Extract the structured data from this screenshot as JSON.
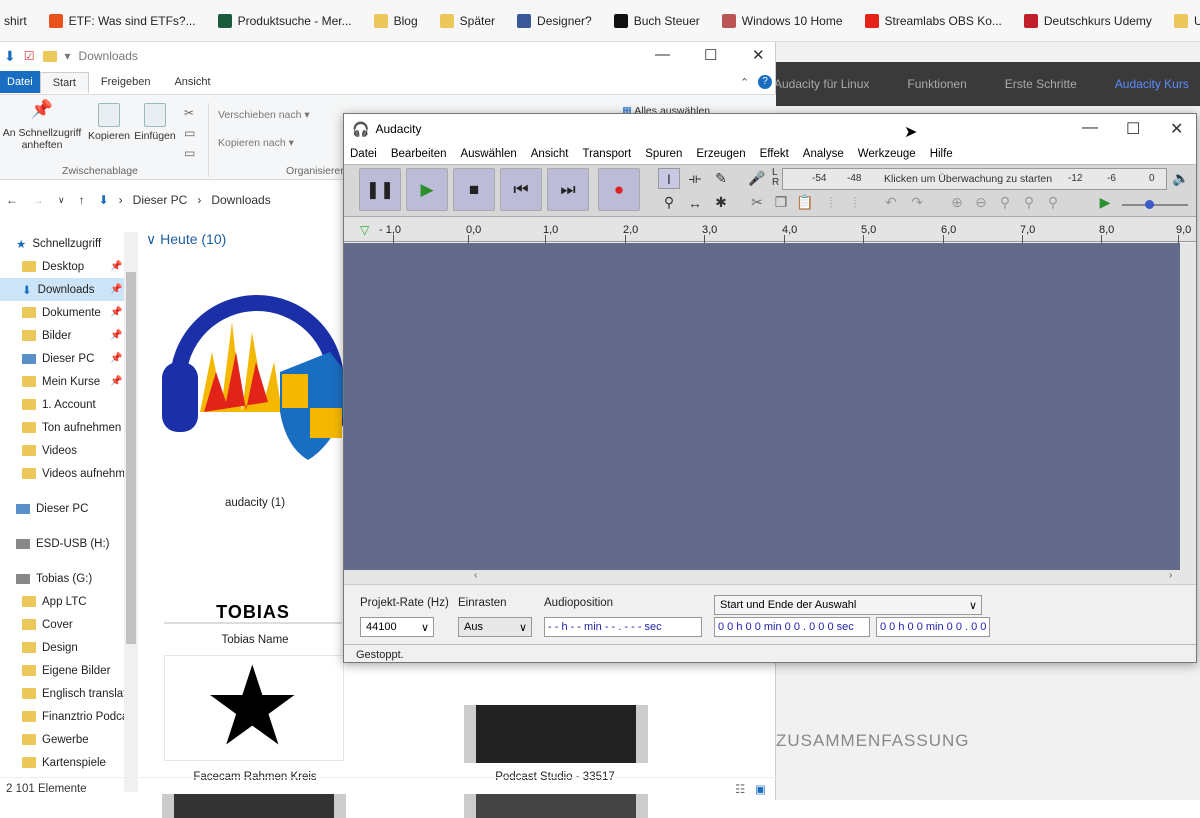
{
  "bookmarks": [
    {
      "label": "shirt",
      "color": "#ffffff"
    },
    {
      "label": "ETF: Was sind ETFs?...",
      "color": "#e8531b"
    },
    {
      "label": "Produktsuche - Mer...",
      "color": "#1a5b3d"
    },
    {
      "label": "Blog",
      "color": "#ecc75a"
    },
    {
      "label": "Später",
      "color": "#ecc75a"
    },
    {
      "label": "Designer?",
      "color": "#3b5998"
    },
    {
      "label": "Buch Steuer",
      "color": "#111111"
    },
    {
      "label": "Windows 10 Home",
      "color": "#bb5555"
    },
    {
      "label": "Streamlabs OBS Ko...",
      "color": "#e62117"
    },
    {
      "label": "Deutschkurs Udemy",
      "color": "#c0202a"
    },
    {
      "label": "Udemy fertig mach...",
      "color": "#ecc75a"
    }
  ],
  "site": {
    "nav": [
      "Audacity für Linux",
      "Funktionen",
      "Erste Schritte",
      "Audacity Kurs"
    ],
    "section": "ZUSAMMENFASSUNG"
  },
  "explorer": {
    "title": "Downloads",
    "tabs": [
      "Datei",
      "Start",
      "Freigeben",
      "Ansicht"
    ],
    "ribbon": {
      "pin": "An Schnellzugriff anheften",
      "copy": "Kopieren",
      "paste": "Einfügen",
      "group_clipboard": "Zwischenablage",
      "move": "Verschieben nach",
      "copyto": "Kopieren nach",
      "group_org": "Organisieren",
      "selectall": "Alles auswählen"
    },
    "breadcrumb": [
      "Dieser PC",
      "Downloads"
    ],
    "nav": [
      {
        "label": "Schnellzugriff",
        "kind": "star",
        "pin": false,
        "sel": false
      },
      {
        "label": "Desktop",
        "kind": "folder",
        "pin": true,
        "sel": false
      },
      {
        "label": "Downloads",
        "kind": "dl",
        "pin": true,
        "sel": true
      },
      {
        "label": "Dokumente",
        "kind": "folder",
        "pin": true,
        "sel": false
      },
      {
        "label": "Bilder",
        "kind": "folder",
        "pin": true,
        "sel": false
      },
      {
        "label": "Dieser PC",
        "kind": "pc",
        "pin": true,
        "sel": false
      },
      {
        "label": "Mein Kurse",
        "kind": "folder",
        "pin": true,
        "sel": false
      },
      {
        "label": "1. Account",
        "kind": "folder",
        "pin": false,
        "sel": false
      },
      {
        "label": "Ton aufnehmen",
        "kind": "folder",
        "pin": false,
        "sel": false
      },
      {
        "label": "Videos",
        "kind": "folder",
        "pin": false,
        "sel": false
      },
      {
        "label": "Videos aufnehm",
        "kind": "folder",
        "pin": false,
        "sel": false
      },
      {
        "label": "",
        "kind": "gap",
        "pin": false,
        "sel": false
      },
      {
        "label": "Dieser PC",
        "kind": "pc",
        "pin": false,
        "sel": false
      },
      {
        "label": "",
        "kind": "gap",
        "pin": false,
        "sel": false
      },
      {
        "label": "ESD-USB (H:)",
        "kind": "drive",
        "pin": false,
        "sel": false
      },
      {
        "label": "",
        "kind": "gap",
        "pin": false,
        "sel": false
      },
      {
        "label": "Tobias (G:)",
        "kind": "drive",
        "pin": false,
        "sel": false
      },
      {
        "label": "App LTC",
        "kind": "folder",
        "pin": false,
        "sel": false
      },
      {
        "label": "Cover",
        "kind": "folder",
        "pin": false,
        "sel": false
      },
      {
        "label": "Design",
        "kind": "folder",
        "pin": false,
        "sel": false
      },
      {
        "label": "Eigene Bilder",
        "kind": "folder",
        "pin": false,
        "sel": false
      },
      {
        "label": "Englisch translat",
        "kind": "folder",
        "pin": false,
        "sel": false
      },
      {
        "label": "Finanztrio Podca",
        "kind": "folder",
        "pin": false,
        "sel": false
      },
      {
        "label": "Gewerbe",
        "kind": "folder",
        "pin": false,
        "sel": false
      },
      {
        "label": "Kartenspiele",
        "kind": "folder",
        "pin": false,
        "sel": false
      }
    ],
    "group": "Heute (10)",
    "files": {
      "audacity": "audacity (1)",
      "tobias_text": "TOBIAS",
      "tobias": "Tobias Name",
      "facecam": "Facecam Rahmen Kreis",
      "podcast": "Podcast Studio - 33517"
    },
    "status": "2 101 Elemente"
  },
  "audacity": {
    "title": "Audacity",
    "menu": [
      "Datei",
      "Bearbeiten",
      "Auswählen",
      "Ansicht",
      "Transport",
      "Spuren",
      "Erzeugen",
      "Effekt",
      "Analyse",
      "Werkzeuge",
      "Hilfe"
    ],
    "meter": {
      "l": "L",
      "r": "R",
      "m54": "-54",
      "m48": "-48",
      "hint": "Klicken um Überwachung zu starten",
      "m12": "-12",
      "m6": "-6",
      "m0": "0"
    },
    "ruler": [
      "- 1,0",
      "0,0",
      "1,0",
      "2,0",
      "3,0",
      "4,0",
      "5,0",
      "6,0",
      "7,0",
      "8,0",
      "9,0"
    ],
    "labels": {
      "rate": "Projekt-Rate (Hz)",
      "snap": "Einrasten",
      "pos": "Audioposition",
      "selmode": "Start und Ende der Auswahl"
    },
    "values": {
      "rate": "44100",
      "snap": "Aus",
      "pos": "- - h - - min - - . - - - sec",
      "start": "0 0 h 0 0 min 0 0 . 0 0 0 sec",
      "end": "0 0 h 0 0 min 0 0 . 0 0"
    },
    "status": "Gestoppt."
  }
}
